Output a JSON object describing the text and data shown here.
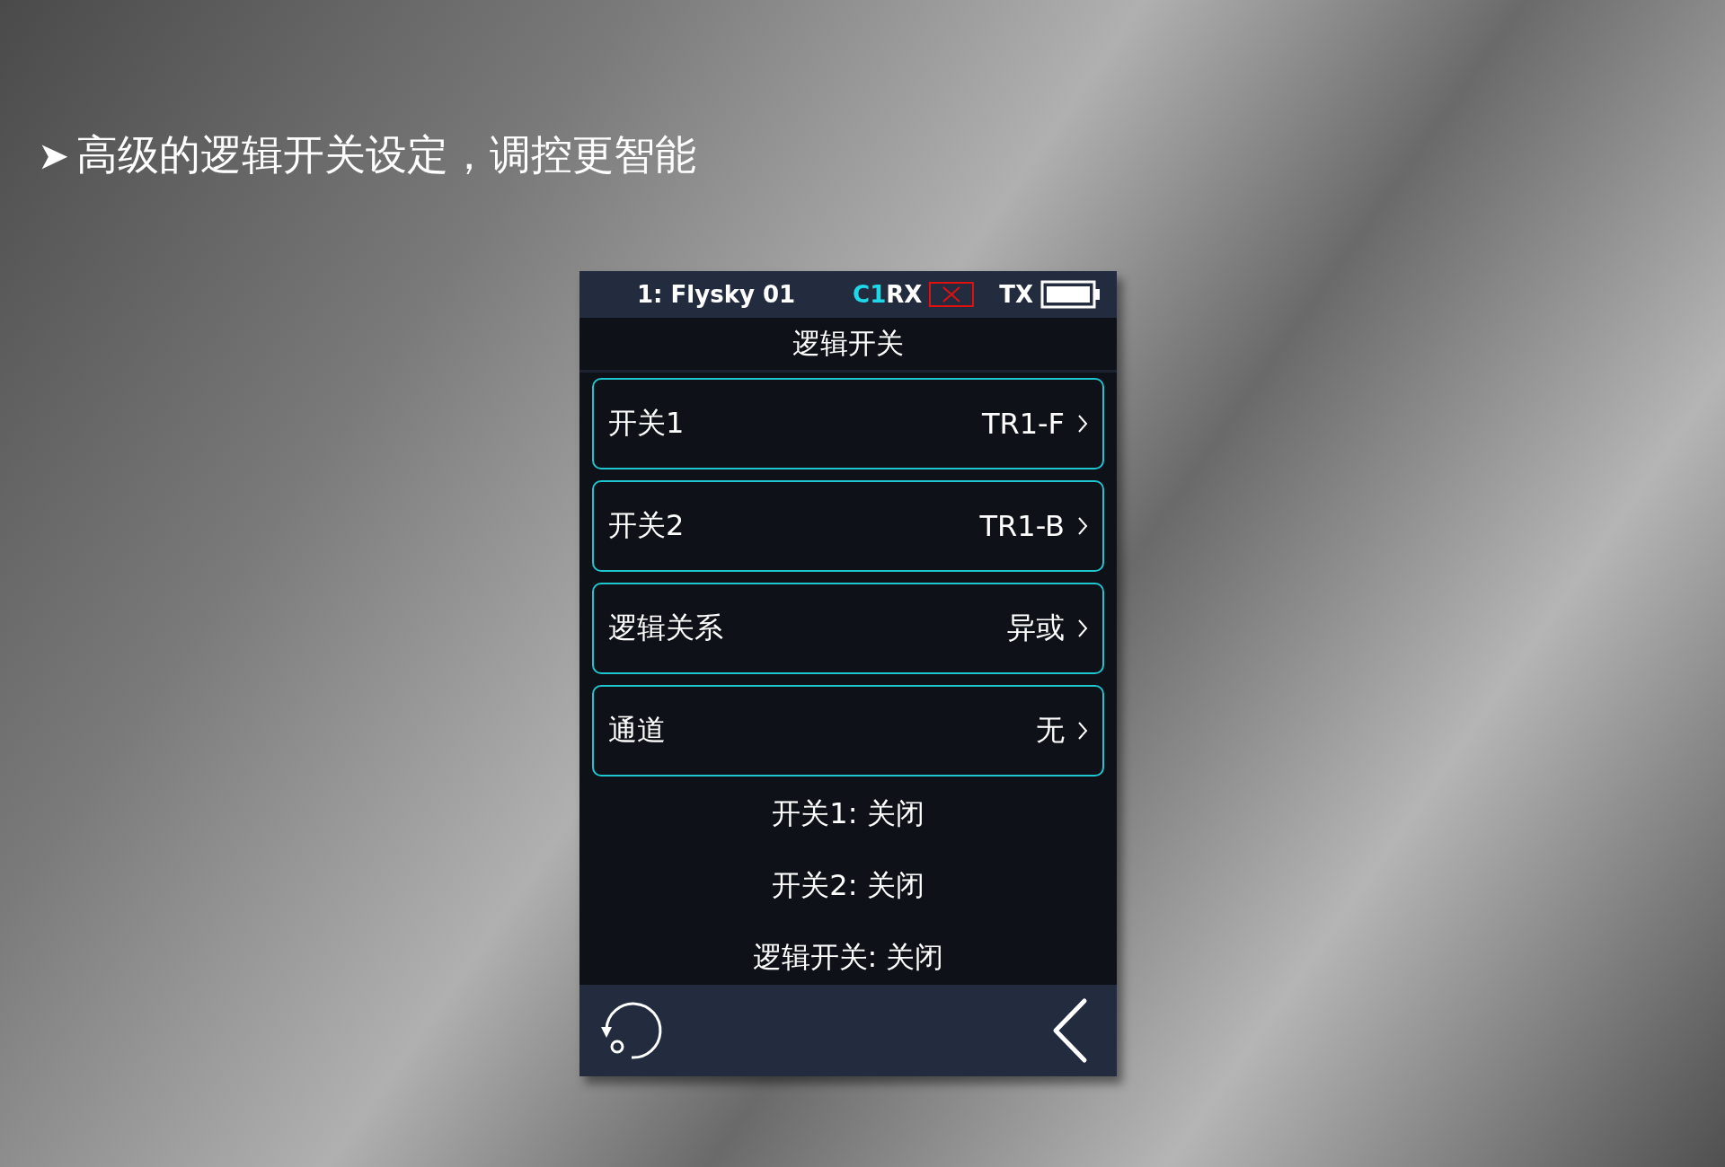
{
  "headline": {
    "marker": "➤",
    "text": "高级的逻辑开关设定，调控更智能"
  },
  "status_bar": {
    "model": "1: Flysky  01",
    "channel": "C1",
    "rx": "RX",
    "tx": "TX"
  },
  "title": "逻辑开关",
  "rows": [
    {
      "label": "开关1",
      "value": "TR1-F"
    },
    {
      "label": "开关2",
      "value": "TR1-B"
    },
    {
      "label": "逻辑关系",
      "value": "异或"
    },
    {
      "label": "通道",
      "value": "无"
    }
  ],
  "status_lines": [
    "开关1: 关闭",
    "开关2: 关闭",
    "逻辑开关: 关闭"
  ]
}
